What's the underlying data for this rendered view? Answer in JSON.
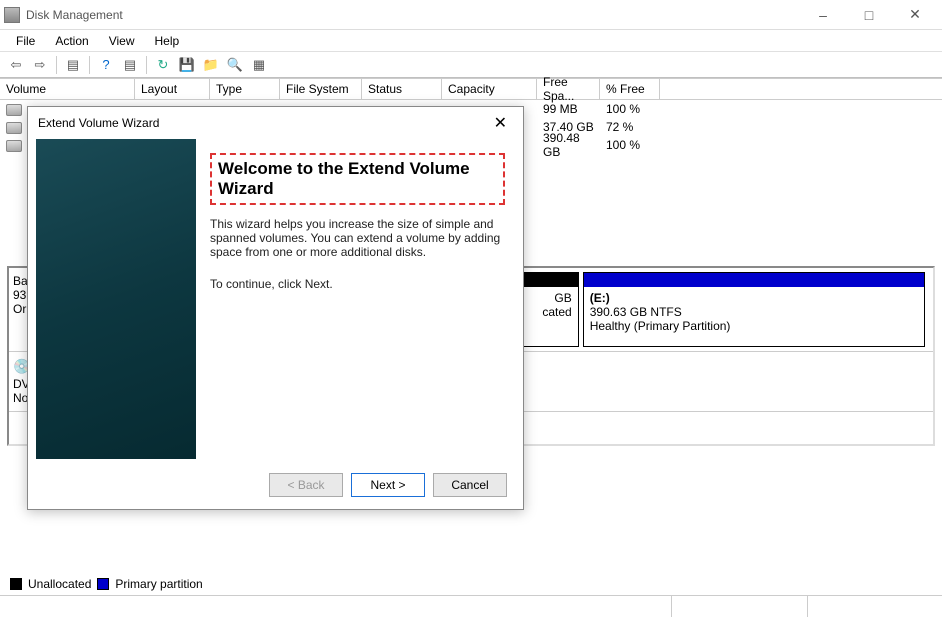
{
  "app": {
    "title": "Disk Management"
  },
  "menu": {
    "file": "File",
    "action": "Action",
    "view": "View",
    "help": "Help"
  },
  "cols": {
    "volume": "Volume",
    "layout": "Layout",
    "type": "Type",
    "fs": "File System",
    "status": "Status",
    "cap": "Capacity",
    "free": "Free Spa...",
    "pfree": "% Free"
  },
  "rows": [
    {
      "free": "99 MB",
      "pfree": "100 %"
    },
    {
      "free": "37.40 GB",
      "pfree": "72 %"
    },
    {
      "free": "390.48 GB",
      "pfree": "100 %"
    }
  ],
  "diskleft": {
    "line1": "Ba",
    "line2": "93",
    "line3": "Or"
  },
  "part1_tail": {
    "l1": "GB",
    "l2": "cated"
  },
  "part2": {
    "label": "(E:)",
    "size": "390.63 GB NTFS",
    "status": "Healthy (Primary Partition)"
  },
  "disk2": {
    "line1": "DV",
    "line2": "No"
  },
  "legend": {
    "unalloc": "Unallocated",
    "primary": "Primary partition"
  },
  "wizard": {
    "title": "Extend Volume Wizard",
    "heading": "Welcome to the Extend Volume Wizard",
    "desc": "This wizard helps you increase the size of simple and spanned volumes. You can extend a volume  by adding space from one or more additional disks.",
    "cont": "To continue, click Next.",
    "back": "< Back",
    "next": "Next >",
    "cancel": "Cancel"
  }
}
